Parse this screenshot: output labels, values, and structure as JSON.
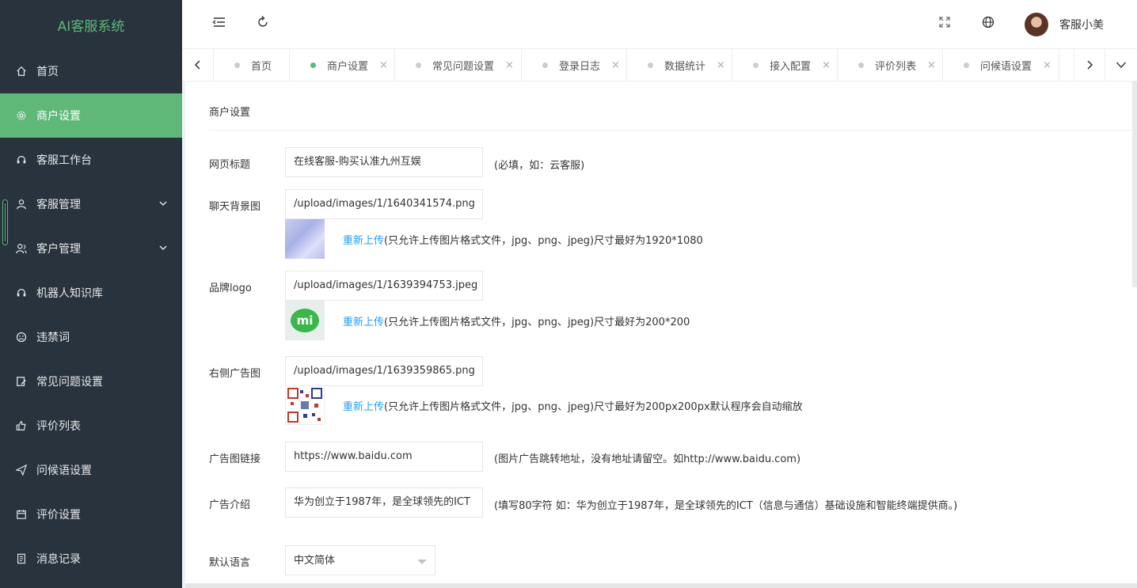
{
  "app": {
    "brand": "AI客服系统"
  },
  "sidebar": {
    "items": [
      {
        "label": "首页",
        "icon": "home-icon"
      },
      {
        "label": "商户设置",
        "icon": "gear-icon",
        "active": true
      },
      {
        "label": "客服工作台",
        "icon": "headset-icon"
      },
      {
        "label": "客服管理",
        "icon": "user-icon",
        "expandable": true
      },
      {
        "label": "客户管理",
        "icon": "users-icon",
        "expandable": true
      },
      {
        "label": "机器人知识库",
        "icon": "headset-icon"
      },
      {
        "label": "违禁词",
        "icon": "face-sad-icon"
      },
      {
        "label": "常见问题设置",
        "icon": "edit-doc-icon"
      },
      {
        "label": "评价列表",
        "icon": "thumbs-up-icon"
      },
      {
        "label": "问候语设置",
        "icon": "send-icon"
      },
      {
        "label": "评价设置",
        "icon": "calendar-icon"
      },
      {
        "label": "消息记录",
        "icon": "doc-icon"
      }
    ]
  },
  "header": {
    "username": "客服小美"
  },
  "tabs": [
    {
      "label": "首页",
      "closable": false
    },
    {
      "label": "商户设置",
      "closable": true,
      "active": true
    },
    {
      "label": "常见问题设置",
      "closable": true
    },
    {
      "label": "登录日志",
      "closable": true
    },
    {
      "label": "数据统计",
      "closable": true
    },
    {
      "label": "接入配置",
      "closable": true
    },
    {
      "label": "评价列表",
      "closable": true
    },
    {
      "label": "问候语设置",
      "closable": true
    }
  ],
  "tab_close_glyph": "×",
  "page": {
    "title": "商户设置",
    "fields": {
      "web_title": {
        "label": "网页标题",
        "value": "在线客服-购买认准九州互娱",
        "hint": "(必填，如：云客服)"
      },
      "chat_bg": {
        "label": "聊天背景图",
        "value": "/upload/images/1/1640341574.png",
        "reupload": "重新上传",
        "note": "(只允许上传图片格式文件，jpg、png、jpeg)尺寸最好为1920*1080"
      },
      "brand_logo": {
        "label": "品牌logo",
        "value": "/upload/images/1/1639394753.jpeg",
        "reupload": "重新上传",
        "note": "(只允许上传图片格式文件，jpg、png、jpeg)尺寸最好为200*200",
        "logo_text": "mi"
      },
      "right_ad": {
        "label": "右侧广告图",
        "value": "/upload/images/1/1639359865.png",
        "reupload": "重新上传",
        "note": "(只允许上传图片格式文件，jpg、png、jpeg)尺寸最好为200px200px默认程序会自动缩放"
      },
      "ad_link": {
        "label": "广告图链接",
        "value": "https://www.baidu.com",
        "hint": "(图片广告跳转地址，没有地址请留空。如http://www.baidu.com)"
      },
      "ad_intro": {
        "label": "广告介绍",
        "value": "华为创立于1987年，是全球领先的ICT",
        "hint": "(填写80字符 如：华为创立于1987年，是全球领先的ICT（信息与通信）基础设施和智能终端提供商。)"
      },
      "default_lang": {
        "label": "默认语言",
        "value": "中文简体"
      }
    }
  },
  "colors": {
    "accent": "#5fb878",
    "sidebar_bg": "#28333e",
    "link": "#1e9fff"
  }
}
